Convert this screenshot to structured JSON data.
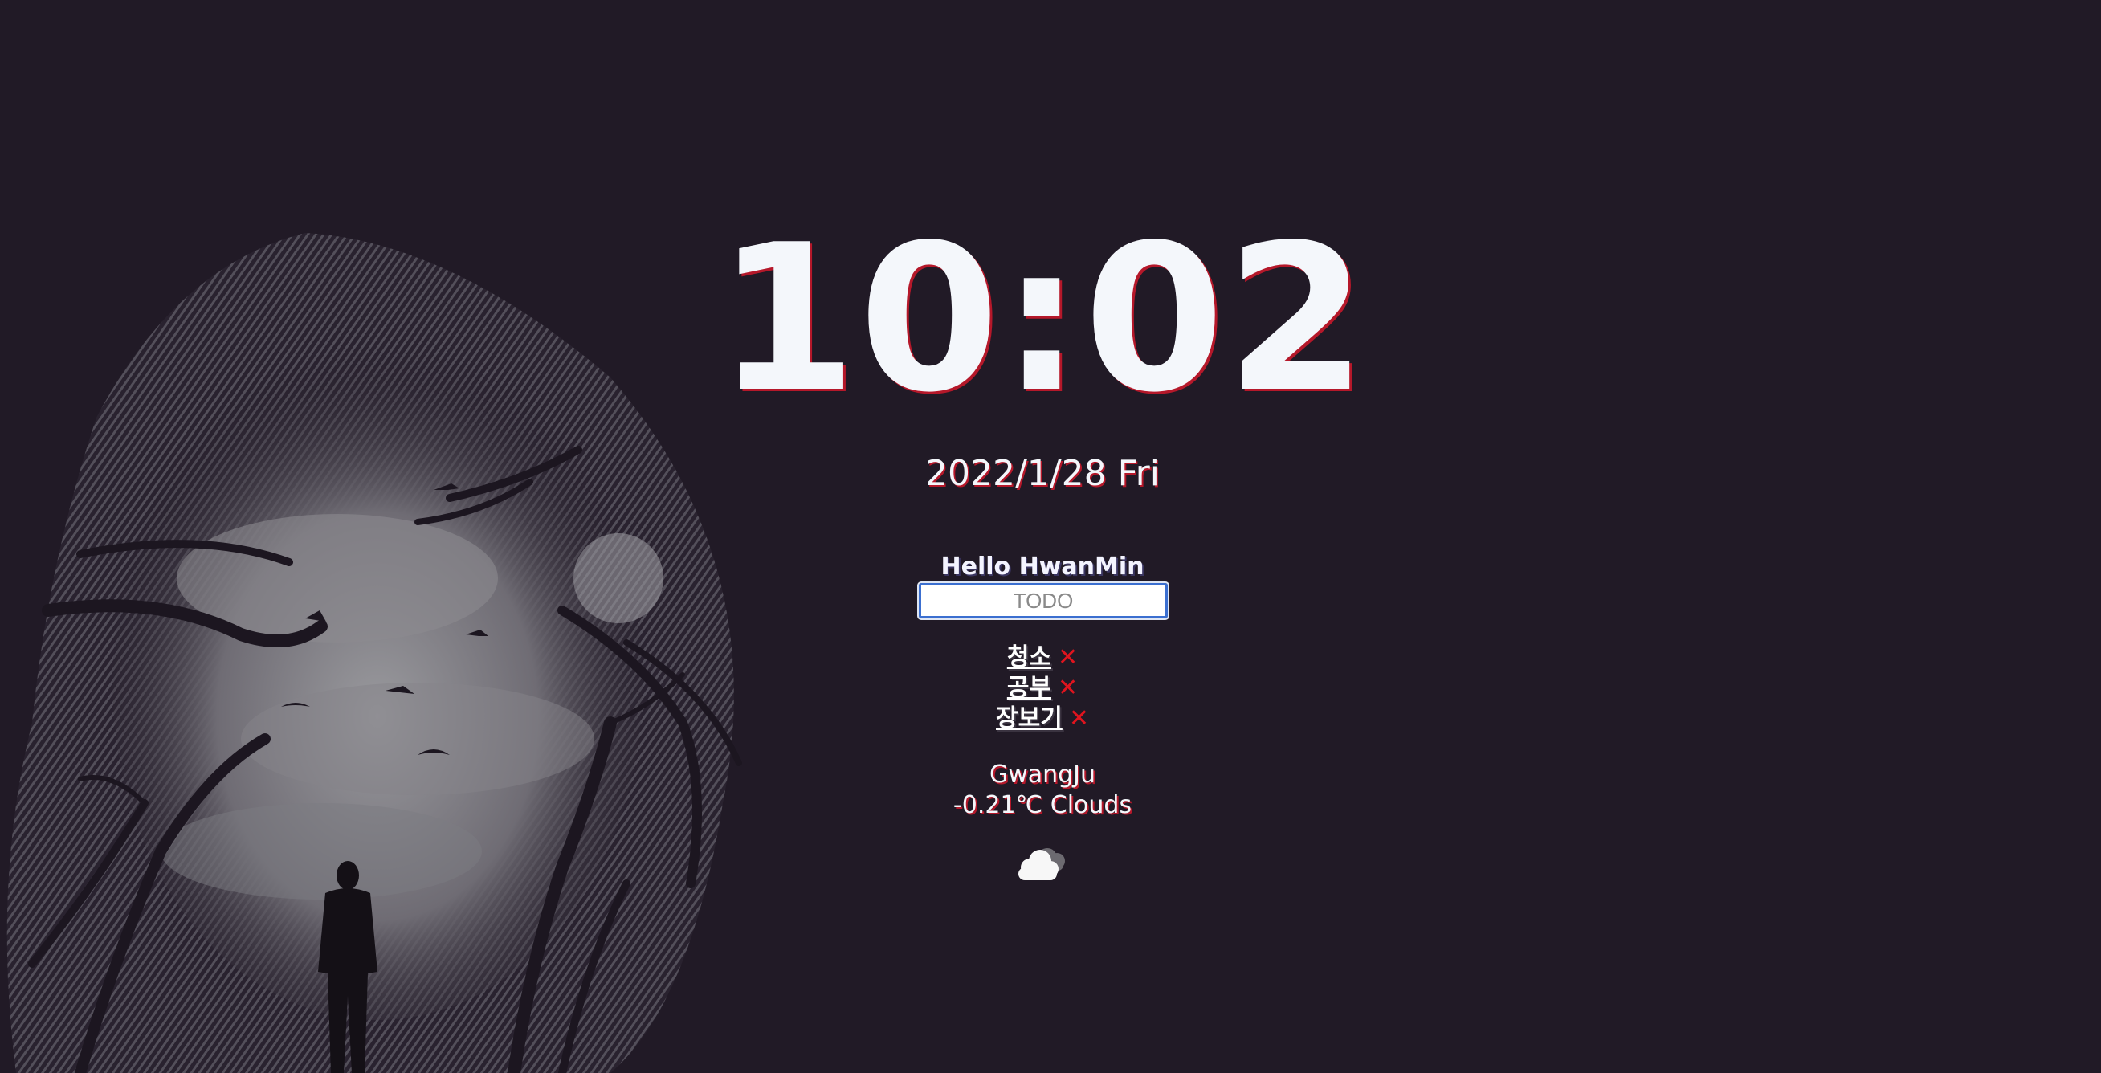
{
  "clock": {
    "time": "10:02"
  },
  "date": {
    "text": "2022/1/28 Fri"
  },
  "greeting": {
    "text": "Hello HwanMin"
  },
  "todo": {
    "placeholder": "TODO",
    "delete_symbol": "✕",
    "items": [
      {
        "label": "청소"
      },
      {
        "label": "공부"
      },
      {
        "label": "장보기"
      }
    ]
  },
  "weather": {
    "city": "GwangJu",
    "description": "-0.21℃ Clouds",
    "icon": "clouds-icon"
  },
  "colors": {
    "background": "#211a26",
    "text": "#f4f7fb",
    "shadow_accent": "#b5182a",
    "delete": "#e0141e",
    "input_border": "#3b6fd0"
  }
}
